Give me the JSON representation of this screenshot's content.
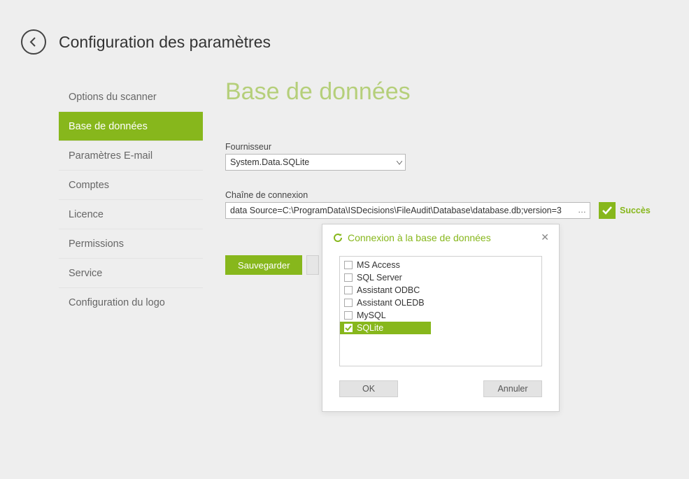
{
  "header": {
    "title": "Configuration des paramètres"
  },
  "sidebar": {
    "items": [
      {
        "label": "Options du scanner"
      },
      {
        "label": "Base de données"
      },
      {
        "label": "Paramètres E-mail"
      },
      {
        "label": "Comptes"
      },
      {
        "label": "Licence"
      },
      {
        "label": "Permissions"
      },
      {
        "label": "Service"
      },
      {
        "label": "Configuration du logo"
      }
    ],
    "active_index": 1
  },
  "main": {
    "title": "Base de données",
    "provider_label": "Fournisseur",
    "provider_value": "System.Data.SQLite",
    "connstr_label": "Chaîne de connexion",
    "connstr_value": "data Source=C:\\ProgramData\\ISDecisions\\FileAudit\\Database\\database.db;version=3",
    "status_text": "Succès",
    "save_label": "Sauvegarder",
    "cancel_label": ""
  },
  "dialog": {
    "title": "Connexion à la base de données",
    "options": [
      {
        "label": "MS Access",
        "checked": false
      },
      {
        "label": "SQL Server",
        "checked": false
      },
      {
        "label": "Assistant ODBC",
        "checked": false
      },
      {
        "label": "Assistant OLEDB",
        "checked": false
      },
      {
        "label": "MySQL",
        "checked": false
      },
      {
        "label": "SQLite",
        "checked": true
      }
    ],
    "ok_label": "OK",
    "cancel_label": "Annuler"
  },
  "colors": {
    "accent": "#87b71c"
  }
}
